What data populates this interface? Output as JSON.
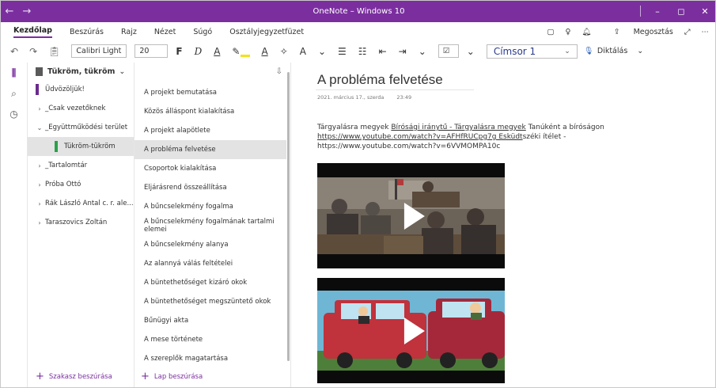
{
  "titlebar": {
    "title": "OneNote – Windows 10",
    "back_icon": "←",
    "forward_icon": "→",
    "minimize_icon": "–",
    "maximize_icon": "◻",
    "close_icon": "✕"
  },
  "ribbon": {
    "tabs": [
      "Kezdőlap",
      "Beszúrás",
      "Rajz",
      "Nézet",
      "Súgó",
      "Osztályjegyzetfüzet"
    ],
    "share_label": "Megosztás"
  },
  "toolbar": {
    "font_name": "Calibri Light",
    "font_size": "20",
    "bold": "F",
    "italic": "D",
    "underline": "A",
    "font_color": "A",
    "style_label": "Címsor 1",
    "dictate_label": "Diktálás"
  },
  "notebook": {
    "name": "Tükröm, tükröm"
  },
  "sections": [
    {
      "label": "Üdvözöljük!",
      "chevron": "",
      "color": "#6b2a8e"
    },
    {
      "label": "_Csak vezetőknek",
      "chevron": "›",
      "color": ""
    },
    {
      "label": "_Együttműködési terület",
      "chevron": "⌄",
      "color": ""
    },
    {
      "label": "Tükröm-tükröm",
      "chevron": "",
      "color": "#29a14a"
    },
    {
      "label": "_Tartalomtár",
      "chevron": "›",
      "color": ""
    },
    {
      "label": "Próba Ottó",
      "chevron": "›",
      "color": ""
    },
    {
      "label": "Rák László Antal c. r. ale...",
      "chevron": "›",
      "color": ""
    },
    {
      "label": "Taraszovics Zoltán",
      "chevron": "›",
      "color": ""
    }
  ],
  "add_section": "Szakasz beszúrása",
  "pages": [
    "A projekt bemutatása",
    "Közös álláspont kialakítása",
    "A projekt alapötlete",
    "A probléma felvetése",
    "Csoportok kialakítása",
    "Eljárásrend összeállítása",
    "A bűncselekmény fogalma",
    "A bűncselekmény fogalmának tartalmi elemei",
    "A bűncselekmény alanya",
    "Az alannyá válás feltételei",
    "A büntethetőséget kizáró okok",
    "A büntethetőséget megszüntető okok",
    "Bűnügyi akta",
    "A mese története",
    "A szereplők magatartása"
  ],
  "add_page": "Lap beszúrása",
  "page": {
    "title": "A probléma felvetése",
    "date": "2021. március 17., szerda",
    "time": "23:49",
    "text_1": "Tárgyalásra megyek ",
    "link_1": "Bírósági iránytű - Tárgyalásra megyek",
    "text_2": " Tanúként a bíróságon",
    "link_2": "https://www.youtube.com/watch?v=AFHfRUCpg7g Esküdt",
    "text_3": "széki ítélet -",
    "text_4": "https://www.youtube.com/watch?v=6VVMOMPA10c"
  }
}
